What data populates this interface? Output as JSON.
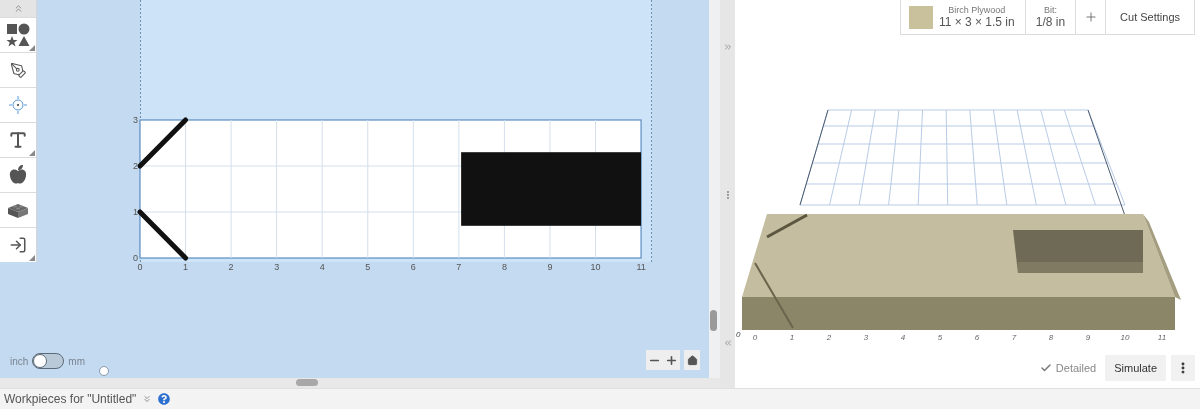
{
  "toolbar": {
    "tools": [
      {
        "selected": false,
        "has_menu": true
      },
      {
        "selected": false,
        "has_menu": false
      },
      {
        "selected": false,
        "has_menu": false
      },
      {
        "selected": false,
        "has_menu": true
      },
      {
        "selected": false,
        "has_menu": false
      },
      {
        "selected": false,
        "has_menu": false
      },
      {
        "selected": false,
        "has_menu": true
      }
    ]
  },
  "canvas": {
    "x_ticks": [
      "0",
      "1",
      "2",
      "3",
      "4",
      "5",
      "6",
      "7",
      "8",
      "9",
      "10",
      "11"
    ],
    "y_ticks": [
      "3",
      "2",
      "1",
      "0"
    ]
  },
  "unit_toggle": {
    "left_label": "inch",
    "right_label": "mm",
    "on": false
  },
  "material": {
    "name": "Birch Plywood",
    "size": "11 × 3 × 1.5 in"
  },
  "bit": {
    "label": "Bit:",
    "value": "1/8 in"
  },
  "cut_settings": {
    "label": "Cut Settings"
  },
  "preview": {
    "x_ticks": [
      "0",
      "1",
      "2",
      "3",
      "4",
      "5",
      "6",
      "7",
      "8",
      "9",
      "10",
      "11"
    ],
    "z_tick": "0"
  },
  "render_mode": {
    "label": "Detailed",
    "checked": true
  },
  "simulate": {
    "label": "Simulate"
  },
  "workpieces": {
    "title": "Workpieces for \"Untitled\""
  }
}
